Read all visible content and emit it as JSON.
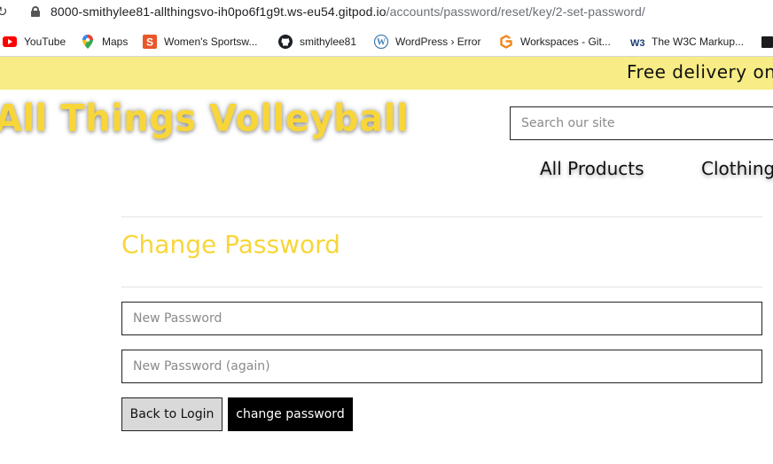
{
  "browser": {
    "url_host": "8000-smithylee81-allthingsvo-ih0po6f1g9t.ws-eu54.gitpod.io",
    "url_path": "/accounts/password/reset/key/2-set-password/",
    "bookmarks": [
      {
        "label": "YouTube",
        "icon": "youtube-icon"
      },
      {
        "label": "Maps",
        "icon": "maps-pin-icon"
      },
      {
        "label": "Women's Sportsw...",
        "icon": "sportswear-s-icon"
      },
      {
        "label": "smithylee81",
        "icon": "github-icon"
      },
      {
        "label": "WordPress › Error",
        "icon": "wordpress-icon"
      },
      {
        "label": "Workspaces - Git...",
        "icon": "gitpod-icon"
      },
      {
        "label": "The W3C Markup...",
        "icon": "w3c-icon"
      }
    ]
  },
  "site": {
    "banner": "Free delivery on",
    "logo": "All Things Volleyball",
    "search_placeholder": "Search our site",
    "nav": [
      {
        "label": "All Products"
      },
      {
        "label": "Clothing"
      }
    ]
  },
  "form": {
    "title": "Change Password",
    "new_password_placeholder": "New Password",
    "new_password_again_placeholder": "New Password (again)",
    "back_label": "Back to Login",
    "submit_label": "change password"
  },
  "colors": {
    "banner_bg": "#f7ec85",
    "accent_yellow": "#f8d63a",
    "submit_bg": "#000000",
    "back_bg": "#d9d9d9"
  }
}
